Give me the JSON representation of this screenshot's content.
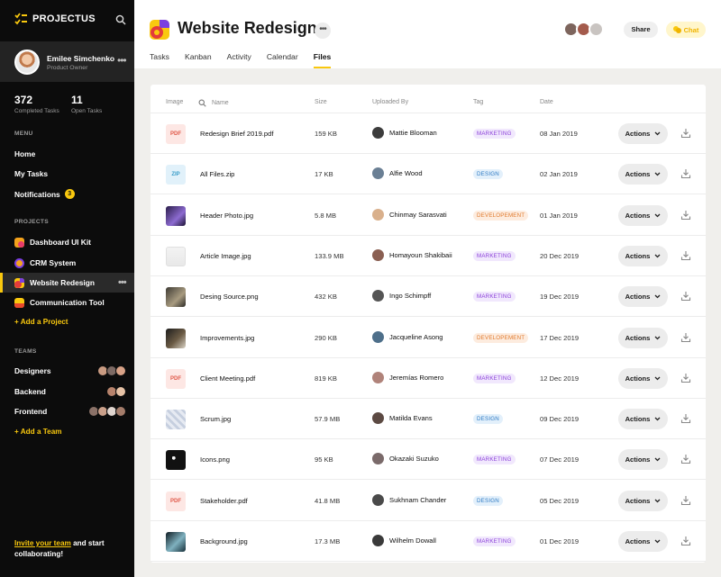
{
  "sidebar": {
    "brand": "PROJECTUS",
    "profile": {
      "name": "Emilee Simchenko",
      "role": "Product Owner"
    },
    "stats": [
      {
        "value": "372",
        "label": "Completed Tasks"
      },
      {
        "value": "11",
        "label": "Open Tasks"
      }
    ],
    "menu_title": "MENU",
    "menu": [
      {
        "label": "Home"
      },
      {
        "label": "My Tasks"
      },
      {
        "label": "Notifications",
        "badge": "3"
      }
    ],
    "projects_title": "PROJECTS",
    "projects": [
      {
        "label": "Dashboard UI Kit",
        "icon": "dashboard-kit-icon"
      },
      {
        "label": "CRM System",
        "icon": "crm-icon"
      },
      {
        "label": "Website Redesign",
        "icon": "website-icon",
        "active": true
      },
      {
        "label": "Communication Tool",
        "icon": "communication-icon"
      }
    ],
    "add_project": "+ Add a Project",
    "teams_title": "TEAMS",
    "teams": [
      {
        "label": "Designers"
      },
      {
        "label": "Backend"
      },
      {
        "label": "Frontend"
      }
    ],
    "add_team": "+ Add a Team",
    "invite_link": "Invite your team",
    "invite_rest": " and start collaborating!"
  },
  "header": {
    "title": "Website Redesign",
    "share_label": "Share",
    "chat_label": "Chat",
    "tabs": [
      {
        "label": "Tasks"
      },
      {
        "label": "Kanban"
      },
      {
        "label": "Activity"
      },
      {
        "label": "Calendar"
      },
      {
        "label": "Files",
        "active": true
      }
    ]
  },
  "table": {
    "columns": {
      "image": "Image",
      "name": "Name",
      "size": "Size",
      "uploaded_by": "Uploaded By",
      "tag": "Tag",
      "date": "Date"
    },
    "action_label": "Actions",
    "rows": [
      {
        "thumb": "PDF",
        "name": "Redesign Brief 2019.pdf",
        "size": "159 KB",
        "user": "Mattie Blooman",
        "tag": "MARKETING",
        "date": "08 Jan 2019"
      },
      {
        "thumb": "ZIP",
        "name": "All Files.zip",
        "size": "17 KB",
        "user": "Alfie Wood",
        "tag": "DESIGN",
        "date": "02 Jan 2019"
      },
      {
        "thumb": "",
        "name": "Header Photo.jpg",
        "size": "5.8 MB",
        "user": "Chinmay Sarasvati",
        "tag": "DEVELOPEMENT",
        "date": "01 Jan 2019"
      },
      {
        "thumb": "",
        "name": "Article Image.jpg",
        "size": "133.9 MB",
        "user": "Homayoun Shakibaii",
        "tag": "MARKETING",
        "date": "20 Dec 2019"
      },
      {
        "thumb": "",
        "name": "Desing Source.png",
        "size": "432 KB",
        "user": "Ingo Schimpff",
        "tag": "MARKETING",
        "date": "19 Dec 2019"
      },
      {
        "thumb": "",
        "name": "Improvements.jpg",
        "size": "290 KB",
        "user": "Jacqueline Asong",
        "tag": "DEVELOPEMENT",
        "date": "17 Dec 2019"
      },
      {
        "thumb": "PDF",
        "name": "Client Meeting.pdf",
        "size": "819 KB",
        "user": "Jeremías Romero",
        "tag": "MARKETING",
        "date": "12 Dec 2019"
      },
      {
        "thumb": "",
        "name": "Scrum.jpg",
        "size": "57.9 MB",
        "user": "Matilda Evans",
        "tag": "DESIGN",
        "date": "09 Dec 2019"
      },
      {
        "thumb": "",
        "name": "Icons.png",
        "size": "95 KB",
        "user": "Okazaki Suzuko",
        "tag": "MARKETING",
        "date": "07 Dec 2019"
      },
      {
        "thumb": "PDF",
        "name": "Stakeholder.pdf",
        "size": "41.8 MB",
        "user": "Sukhnam Chander",
        "tag": "DESIGN",
        "date": "05 Dec 2019"
      },
      {
        "thumb": "",
        "name": "Background.jpg",
        "size": "17.3 MB",
        "user": "Wilhelm Dowall",
        "tag": "MARKETING",
        "date": "01 Dec 2019"
      }
    ]
  },
  "colors": {
    "accent": "#f9c80e",
    "sidebar": "#0c0c0c",
    "marketing": "#8a3fd9",
    "design": "#2f7bc4",
    "developement": "#e07a2d"
  }
}
